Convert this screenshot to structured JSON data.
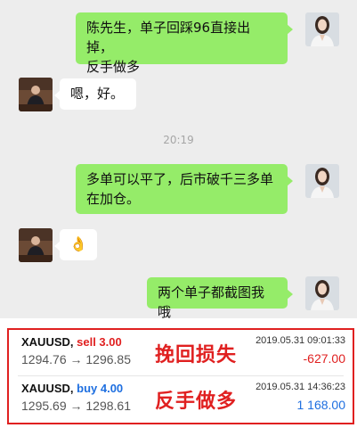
{
  "messages": [
    {
      "text_lines": [
        "陈先生，单子回踩96直接出掉，",
        "反手做多"
      ]
    },
    {
      "text": "嗯，好。"
    },
    {
      "time": "20:19"
    },
    {
      "text_lines": [
        "多单可以平了，后市破千三多单",
        "在加仓。"
      ]
    },
    {
      "emoji": "👌"
    },
    {
      "text": "两个单子都截图我哦"
    }
  ],
  "trades": [
    {
      "symbol": "XAUUSD,",
      "side": "sell 3.00",
      "prices": "1294.76 → 1296.85",
      "datetime": "2019.05.31 09:01:33",
      "pnl": "-627.00",
      "note": "挽回损失"
    },
    {
      "symbol": "XAUUSD,",
      "side": "buy 4.00",
      "prices": "1295.69 → 1298.61",
      "datetime": "2019.05.31 14:36:23",
      "pnl": "1 168.00",
      "note": "反手做多"
    }
  ],
  "colors": {
    "chat_bg": "#ededed",
    "bubble_green": "#95ec69",
    "bubble_white": "#ffffff",
    "sell": "#e02020",
    "buy": "#1e6fe0",
    "annotation": "#e02020",
    "loss": "#e02020",
    "profit": "#1e6fe0"
  },
  "icons": {
    "user_avatar": "woman-portrait-avatar",
    "contact_avatar": "man-at-desk-avatar"
  }
}
